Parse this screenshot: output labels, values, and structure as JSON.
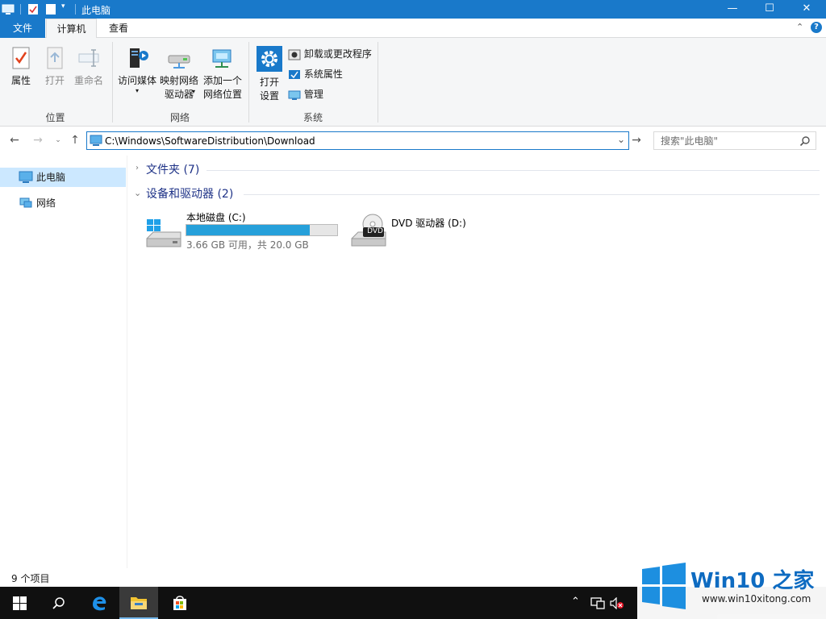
{
  "window": {
    "title": "此电脑",
    "controls": {
      "minimize": "—",
      "maximize": "☐",
      "close": "✕"
    }
  },
  "ribbon": {
    "tabs": [
      {
        "label": "文件"
      },
      {
        "label": "计算机"
      },
      {
        "label": "查看"
      }
    ],
    "groups": {
      "location": {
        "label": "位置",
        "buttons": {
          "properties": "属性",
          "open": "打开",
          "rename": "重命名"
        }
      },
      "network": {
        "label": "网络",
        "buttons": {
          "access_media": "访问媒体",
          "map_drive_1": "映射网络",
          "map_drive_2": "驱动器",
          "add_location_1": "添加一个",
          "add_location_2": "网络位置"
        }
      },
      "system": {
        "label": "系统",
        "buttons": {
          "open_settings_1": "打开",
          "open_settings_2": "设置",
          "uninstall": "卸载或更改程序",
          "sys_properties": "系统属性",
          "manage": "管理"
        }
      }
    }
  },
  "address": {
    "path": "C:\\Windows\\SoftwareDistribution\\Download"
  },
  "search": {
    "placeholder": "搜索\"此电脑\""
  },
  "nav": {
    "items": [
      {
        "label": "此电脑"
      },
      {
        "label": "网络"
      }
    ]
  },
  "content": {
    "folders_header": "文件夹 (7)",
    "devices_header": "设备和驱动器 (2)",
    "drives": [
      {
        "name": "本地磁盘 (C:)",
        "detail": "3.66 GB 可用，共 20.0 GB",
        "used_fraction": 0.817
      },
      {
        "name": "DVD 驱动器 (D:)",
        "badge": "DVD"
      }
    ]
  },
  "status": {
    "count": "9 个项目"
  },
  "watermark": {
    "brand": "Win10 之家",
    "url": "www.win10xitong.com"
  },
  "colors": {
    "accent": "#1979ca",
    "selection": "#cce8ff",
    "drive_bar": "#26a0da"
  }
}
